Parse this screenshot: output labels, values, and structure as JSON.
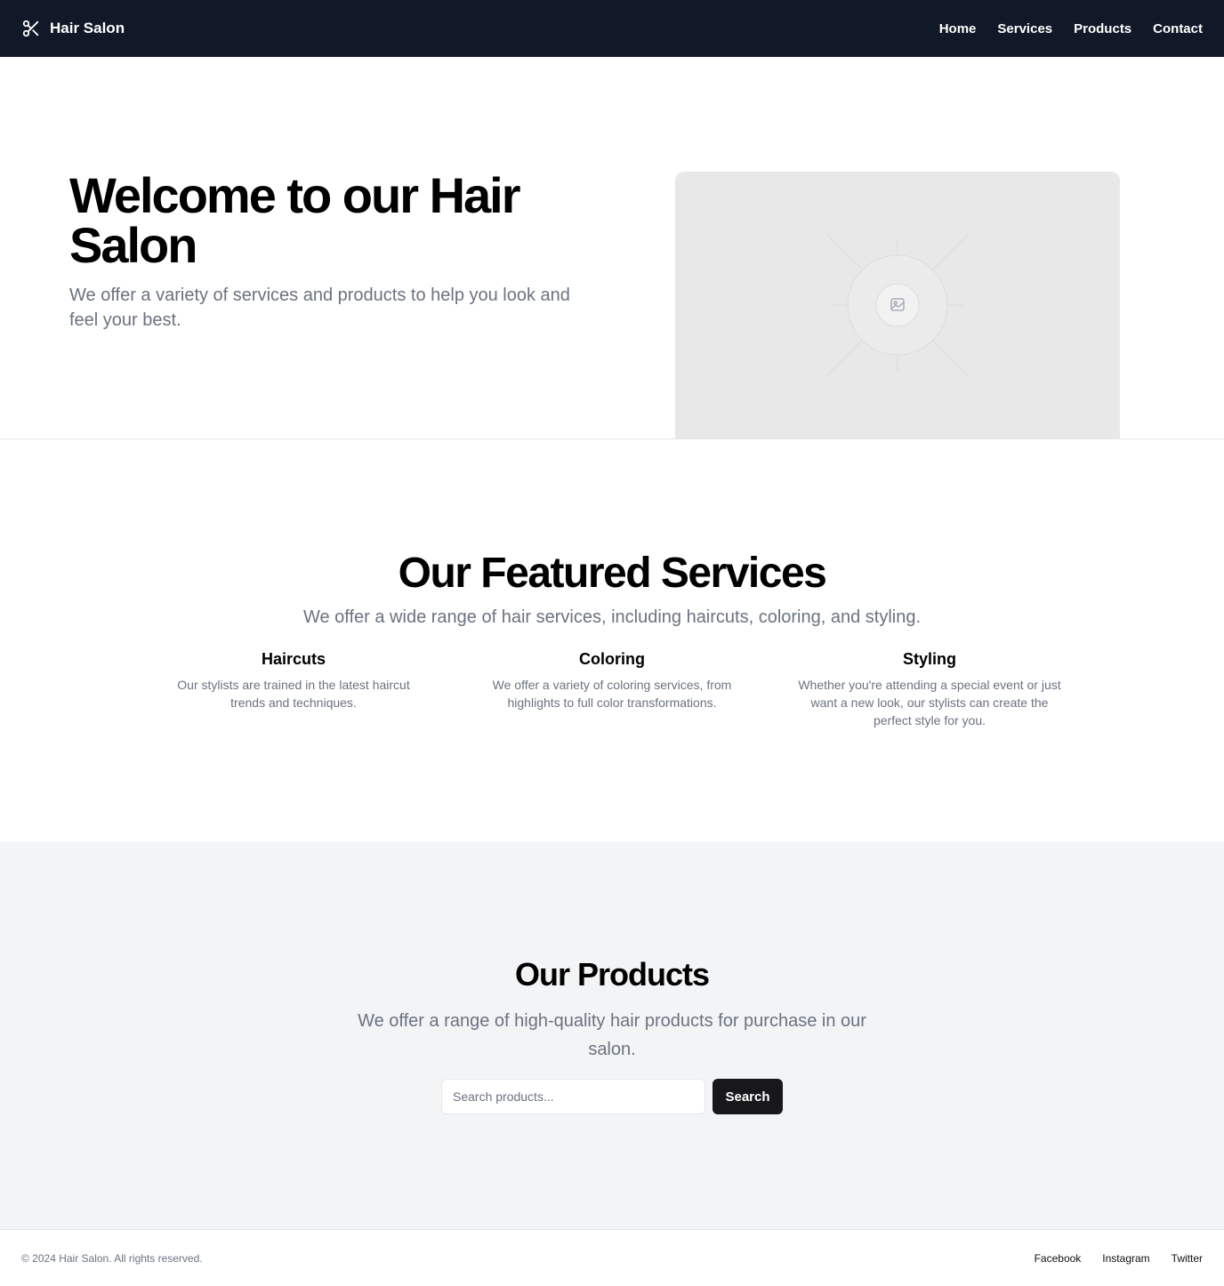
{
  "header": {
    "brand_name": "Hair Salon",
    "logo_icon": "scissors-icon",
    "nav": [
      {
        "label": "Home"
      },
      {
        "label": "Services"
      },
      {
        "label": "Products"
      },
      {
        "label": "Contact"
      }
    ]
  },
  "hero": {
    "title": "Welcome to our Hair Salon",
    "subtitle": "We offer a variety of services and products to help you look and feel your best.",
    "image_icon": "image-placeholder-icon"
  },
  "services": {
    "title": "Our Featured Services",
    "subtitle": "We offer a wide range of hair services, including haircuts, coloring, and styling.",
    "items": [
      {
        "title": "Haircuts",
        "description": "Our stylists are trained in the latest haircut trends and techniques."
      },
      {
        "title": "Coloring",
        "description": "We offer a variety of coloring services, from highlights to full color transformations."
      },
      {
        "title": "Styling",
        "description": "Whether you're attending a special event or just want a new look, our stylists can create the perfect style for you."
      }
    ]
  },
  "products": {
    "title": "Our Products",
    "subtitle": "We offer a range of high-quality hair products for purchase in our salon.",
    "search_placeholder": "Search products...",
    "search_value": "",
    "search_button": "Search"
  },
  "footer": {
    "copyright": "© 2024 Hair Salon. All rights reserved.",
    "links": [
      {
        "label": "Facebook"
      },
      {
        "label": "Instagram"
      },
      {
        "label": "Twitter"
      }
    ]
  },
  "colors": {
    "header_bg": "#111827",
    "products_bg": "#f3f4f6",
    "button_bg": "#18181b",
    "muted_text": "#6b7280"
  }
}
